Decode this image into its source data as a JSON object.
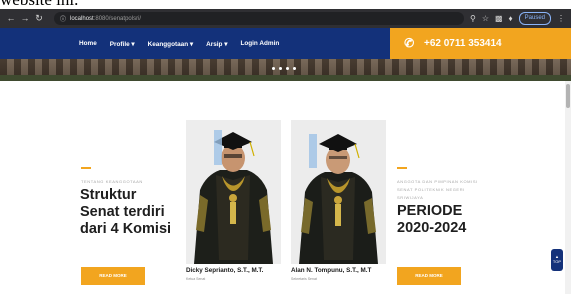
{
  "caption_fragment": "website ini.",
  "browser": {
    "back_icon": "arrow-left-icon",
    "forward_icon": "arrow-right-icon",
    "reload_icon": "reload-icon",
    "url_host": "localhost",
    "url_path": ":8080/senatpolsri/",
    "profile_pill": "Paused"
  },
  "nav": {
    "items": [
      {
        "label": "Home"
      },
      {
        "label": "Profile ▾"
      },
      {
        "label": "Keanggotaan ▾"
      },
      {
        "label": "Arsip ▾"
      },
      {
        "label": "Login Admin"
      }
    ],
    "phone": "+62 0711 353414",
    "phone_icon": "phone-icon"
  },
  "hero": {
    "dots": [
      1,
      2,
      3,
      4
    ]
  },
  "left_block": {
    "eyebrow": "TENTANG KEANGGOTAAN",
    "title_line1": "Struktur",
    "title_line2": "Senat terdiri",
    "title_line3": "dari 4 Komisi",
    "button": "READ MORE"
  },
  "people": [
    {
      "name": "Dicky Seprianto, S.T., M.T.",
      "role": "Ketua Senat"
    },
    {
      "name": "Alan N. Tompunu, S.T., M.T",
      "role": "Sekretaris Senat"
    }
  ],
  "right_block": {
    "eyebrow_line1": "ANGGOTA DAN PIMPINAN KOMISI",
    "eyebrow_line2": "SENAT POLITEKNIK NEGERI",
    "eyebrow_line3": "SRIWIJAYA",
    "title_line1": "PERIODE",
    "title_line2": "2020-2024",
    "button": "READ MORE"
  },
  "to_top": {
    "label": "TOP",
    "icon": "chevron-up-icon"
  },
  "colors": {
    "nav_blue": "#13317a",
    "accent_orange": "#f2a51f"
  }
}
